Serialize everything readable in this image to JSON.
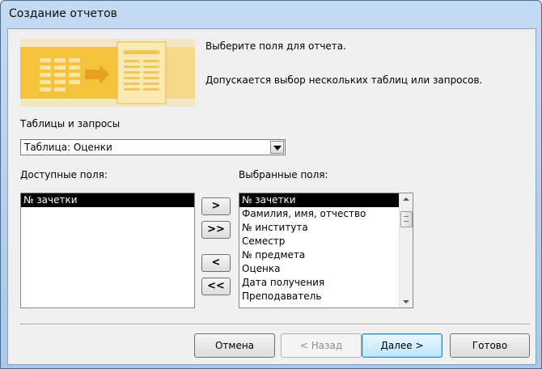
{
  "window": {
    "title": "Создание отчетов"
  },
  "intro": {
    "heading": "Выберите поля для отчета.",
    "subtext": "Допускается выбор нескольких таблиц или запросов."
  },
  "source": {
    "label": "Таблицы и запросы",
    "selected": "Таблица: Оценки"
  },
  "available": {
    "label": "Доступные поля:",
    "items": [
      "№ зачетки"
    ]
  },
  "selected_fields": {
    "label": "Выбранные поля:",
    "items": [
      "№ зачетки",
      "Фамилия, имя, отчество",
      "№ института",
      "Семестр",
      "№ предмета",
      "Оценка",
      "Дата получения",
      "Преподаватель"
    ]
  },
  "move_buttons": {
    "add_one": ">",
    "add_all": ">>",
    "remove_one": "<",
    "remove_all": "<<"
  },
  "footer": {
    "cancel": "Отмена",
    "back": "< Назад",
    "next": "Далее >",
    "finish": "Готово"
  },
  "colors": {
    "banner": "#f3e6c7",
    "banner_accent": "#f5c23c",
    "selection": "#000000"
  },
  "icons": [
    "wizard-banner-image",
    "combo-dropdown-icon"
  ]
}
